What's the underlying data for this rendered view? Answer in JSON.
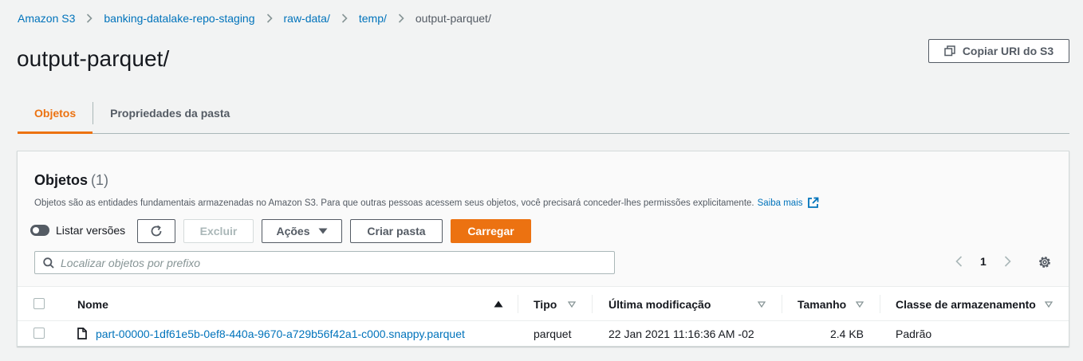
{
  "breadcrumb": {
    "items": [
      "Amazon S3",
      "banking-datalake-repo-staging",
      "raw-data/",
      "temp/"
    ],
    "current": "output-parquet/"
  },
  "page": {
    "title": "output-parquet/",
    "copy_uri_label": "Copiar URI do S3"
  },
  "tabs": [
    {
      "label": "Objetos",
      "active": true
    },
    {
      "label": "Propriedades da pasta",
      "active": false
    }
  ],
  "objects_panel": {
    "title": "Objetos",
    "count": "(1)",
    "description": "Objetos são as entidades fundamentais armazenadas no Amazon S3. Para que outras pessoas acessem seus objetos, você precisará conceder-lhes permissões explicitamente.",
    "learn_more": "Saiba mais",
    "toggle_label": "Listar versões",
    "buttons": {
      "delete": "Excluir",
      "actions": "Ações",
      "create_folder": "Criar pasta",
      "upload": "Carregar"
    },
    "search_placeholder": "Localizar objetos por prefixo",
    "page_number": "1"
  },
  "table": {
    "columns": [
      "Nome",
      "Tipo",
      "Última modificação",
      "Tamanho",
      "Classe de armazenamento"
    ],
    "rows": [
      {
        "name": "part-00000-1df61e5b-0ef8-440a-9670-a729b56f42a1-c000.snappy.parquet",
        "type": "parquet",
        "modified": "22 Jan 2021 11:16:36 AM -02",
        "size": "2.4 KB",
        "storage_class": "Padrão"
      }
    ]
  },
  "colors": {
    "link": "#0073bb",
    "accent_orange": "#ec7211",
    "text": "#16191f",
    "muted": "#545b64"
  },
  "icons": [
    "chevron-right-icon",
    "copy-icon",
    "external-link-icon",
    "refresh-icon",
    "caret-down-icon",
    "search-icon",
    "chevron-left-icon",
    "gear-icon",
    "sort-asc-icon",
    "sort-icon",
    "file-icon"
  ]
}
